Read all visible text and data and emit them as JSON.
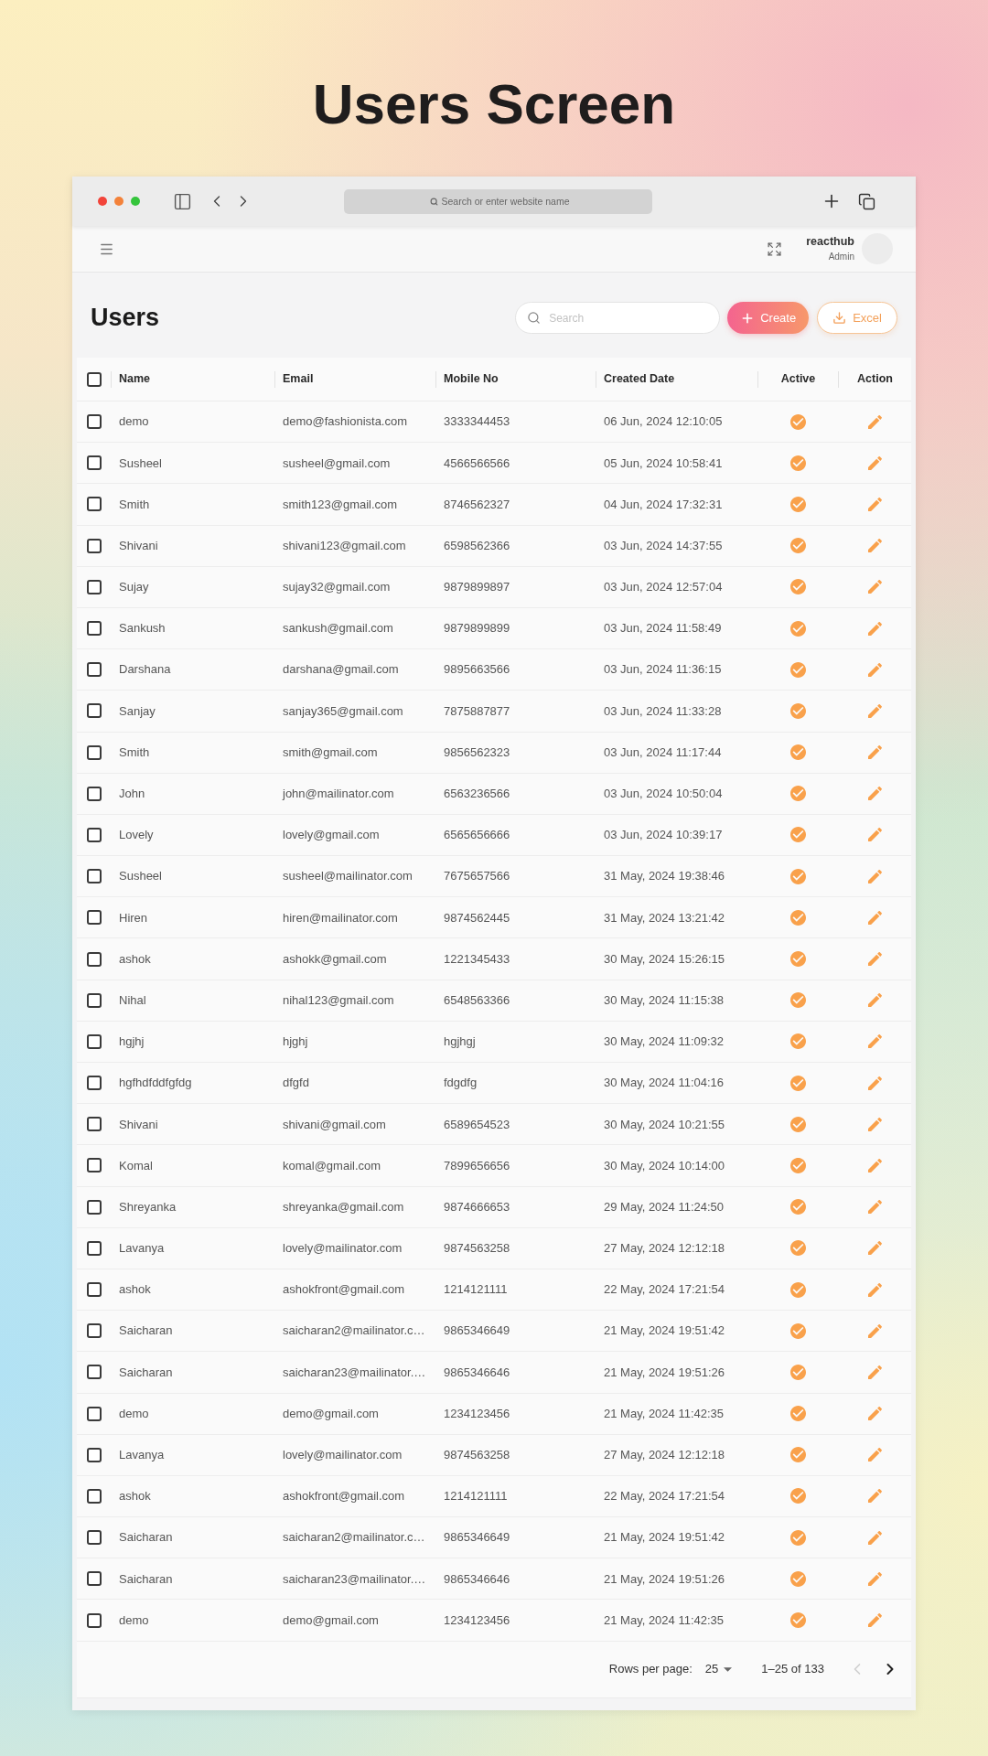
{
  "title": "Users Screen",
  "browser": {
    "address_bar": {
      "placeholder": "Search or enter website name"
    }
  },
  "app_header": {
    "user": {
      "name": "reacthub",
      "role": "Admin"
    }
  },
  "page": {
    "heading": "Users",
    "search": {
      "placeholder": "Search"
    },
    "buttons": [
      {
        "kind": "primary",
        "label": "Create"
      },
      {
        "kind": "outline",
        "label": "Excel"
      }
    ]
  },
  "table": {
    "select_all": {
      "checked": false
    },
    "columns": [
      "Name",
      "Email",
      "Mobile No",
      "Created Date",
      "Active",
      "Action"
    ],
    "rows": [
      {
        "checked": false,
        "name": "demo",
        "email": "demo@fashionista.com",
        "mobile": "3333344453",
        "created": "06 Jun, 2024 12:10:05",
        "active": true
      },
      {
        "checked": false,
        "name": "Susheel",
        "email": "susheel@gmail.com",
        "mobile": "4566566566",
        "created": "05 Jun, 2024 10:58:41",
        "active": true
      },
      {
        "checked": false,
        "name": "Smith",
        "email": "smith123@gmail.com",
        "mobile": "8746562327",
        "created": "04 Jun, 2024 17:32:31",
        "active": true
      },
      {
        "checked": false,
        "name": "Shivani",
        "email": "shivani123@gmail.com",
        "mobile": "6598562366",
        "created": "03 Jun, 2024 14:37:55",
        "active": true
      },
      {
        "checked": false,
        "name": "Sujay",
        "email": "sujay32@gmail.com",
        "mobile": "9879899897",
        "created": "03 Jun, 2024 12:57:04",
        "active": true
      },
      {
        "checked": false,
        "name": "Sankush",
        "email": "sankush@gmail.com",
        "mobile": "9879899899",
        "created": "03 Jun, 2024 11:58:49",
        "active": true
      },
      {
        "checked": false,
        "name": "Darshana",
        "email": "darshana@gmail.com",
        "mobile": "9895663566",
        "created": "03 Jun, 2024 11:36:15",
        "active": true
      },
      {
        "checked": false,
        "name": "Sanjay",
        "email": "sanjay365@gmail.com",
        "mobile": "7875887877",
        "created": "03 Jun, 2024 11:33:28",
        "active": true
      },
      {
        "checked": false,
        "name": "Smith",
        "email": "smith@gmail.com",
        "mobile": "9856562323",
        "created": "03 Jun, 2024 11:17:44",
        "active": true
      },
      {
        "checked": false,
        "name": "John",
        "email": "john@mailinator.com",
        "mobile": "6563236566",
        "created": "03 Jun, 2024 10:50:04",
        "active": true
      },
      {
        "checked": false,
        "name": "Lovely",
        "email": "lovely@gmail.com",
        "mobile": "6565656666",
        "created": "03 Jun, 2024 10:39:17",
        "active": true
      },
      {
        "checked": false,
        "name": "Susheel",
        "email": "susheel@mailinator.com",
        "mobile": "7675657566",
        "created": "31 May, 2024 19:38:46",
        "active": true
      },
      {
        "checked": false,
        "name": "Hiren",
        "email": "hiren@mailinator.com",
        "mobile": "9874562445",
        "created": "31 May, 2024 13:21:42",
        "active": true
      },
      {
        "checked": false,
        "name": "ashok",
        "email": "ashokk@gmail.com",
        "mobile": "1221345433",
        "created": "30 May, 2024 15:26:15",
        "active": true
      },
      {
        "checked": false,
        "name": "Nihal",
        "email": "nihal123@gmail.com",
        "mobile": "6548563366",
        "created": "30 May, 2024 11:15:38",
        "active": true
      },
      {
        "checked": false,
        "name": "hgjhj",
        "email": "hjghj",
        "mobile": "hgjhgj",
        "created": "30 May, 2024 11:09:32",
        "active": true
      },
      {
        "checked": false,
        "name": "hgfhdfddfgfdg",
        "email": "dfgfd",
        "mobile": "fdgdfg",
        "created": "30 May, 2024 11:04:16",
        "active": true
      },
      {
        "checked": false,
        "name": "Shivani",
        "email": "shivani@gmail.com",
        "mobile": "6589654523",
        "created": "30 May, 2024 10:21:55",
        "active": true
      },
      {
        "checked": false,
        "name": "Komal",
        "email": "komal@gmail.com",
        "mobile": "7899656656",
        "created": "30 May, 2024 10:14:00",
        "active": true
      },
      {
        "checked": false,
        "name": "Shreyanka",
        "email": "shreyanka@gmail.com",
        "mobile": "9874666653",
        "created": "29 May, 2024 11:24:50",
        "active": true
      },
      {
        "checked": false,
        "name": "Lavanya",
        "email": "lovely@mailinator.com",
        "mobile": "9874563258",
        "created": "27 May, 2024 12:12:18",
        "active": true
      },
      {
        "checked": false,
        "name": "ashok",
        "email": "ashokfront@gmail.com",
        "mobile": "1214121111",
        "created": "22 May, 2024 17:21:54",
        "active": true
      },
      {
        "checked": false,
        "name": "Saicharan",
        "email": "saicharan2@mailinator.c…",
        "mobile": "9865346649",
        "created": "21 May, 2024 19:51:42",
        "active": true
      },
      {
        "checked": false,
        "name": "Saicharan",
        "email": "saicharan23@mailinator.…",
        "mobile": "9865346646",
        "created": "21 May, 2024 19:51:26",
        "active": true
      },
      {
        "checked": false,
        "name": "demo",
        "email": "demo@gmail.com",
        "mobile": "1234123456",
        "created": "21 May, 2024 11:42:35",
        "active": true
      },
      {
        "checked": false,
        "name": "Lavanya",
        "email": "lovely@mailinator.com",
        "mobile": "9874563258",
        "created": "27 May, 2024 12:12:18",
        "active": true
      },
      {
        "checked": false,
        "name": "ashok",
        "email": "ashokfront@gmail.com",
        "mobile": "1214121111",
        "created": "22 May, 2024 17:21:54",
        "active": true
      },
      {
        "checked": false,
        "name": "Saicharan",
        "email": "saicharan2@mailinator.c…",
        "mobile": "9865346649",
        "created": "21 May, 2024 19:51:42",
        "active": true
      },
      {
        "checked": false,
        "name": "Saicharan",
        "email": "saicharan23@mailinator.…",
        "mobile": "9865346646",
        "created": "21 May, 2024 19:51:26",
        "active": true
      },
      {
        "checked": false,
        "name": "demo",
        "email": "demo@gmail.com",
        "mobile": "1234123456",
        "created": "21 May, 2024 11:42:35",
        "active": true
      }
    ]
  },
  "pagination": {
    "rows_per_page_label": "Rows per page:",
    "rows_per_page": "25",
    "range": "1–25 of 133",
    "prev": {
      "disabled": true
    },
    "next": {
      "disabled": false
    }
  }
}
